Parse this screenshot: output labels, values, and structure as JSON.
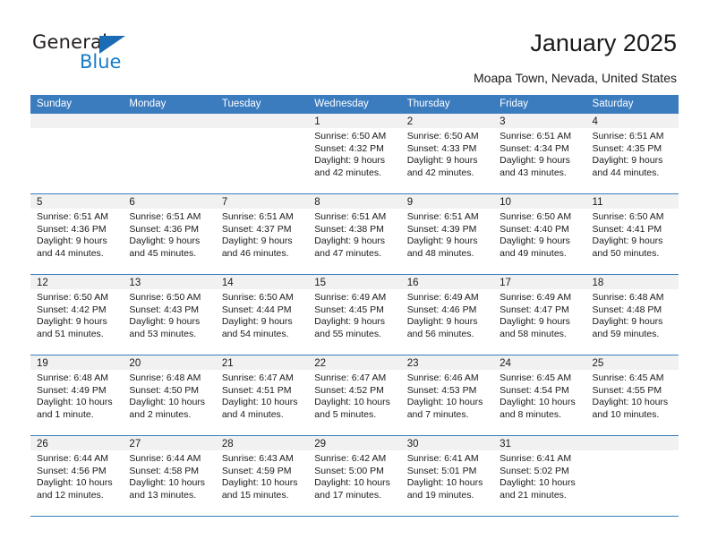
{
  "brand": {
    "name_part1": "General",
    "name_part2": "Blue",
    "triangle_color": "#1c6cb5",
    "blue_color": "#1a7bc6"
  },
  "header": {
    "title": "January 2025",
    "subtitle": "Moapa Town, Nevada, United States",
    "header_bg": "#3b7cbf",
    "daynum_bg": "#f1f1f1"
  },
  "weekdays": [
    "Sunday",
    "Monday",
    "Tuesday",
    "Wednesday",
    "Thursday",
    "Friday",
    "Saturday"
  ],
  "weeks": [
    [
      {
        "day": "",
        "empty": true,
        "l1": "",
        "l2": "",
        "l3": "",
        "l4": ""
      },
      {
        "day": "",
        "empty": true,
        "l1": "",
        "l2": "",
        "l3": "",
        "l4": ""
      },
      {
        "day": "",
        "empty": true,
        "l1": "",
        "l2": "",
        "l3": "",
        "l4": ""
      },
      {
        "day": "1",
        "empty": false,
        "l1": "Sunrise: 6:50 AM",
        "l2": "Sunset: 4:32 PM",
        "l3": "Daylight: 9 hours",
        "l4": "and 42 minutes."
      },
      {
        "day": "2",
        "empty": false,
        "l1": "Sunrise: 6:50 AM",
        "l2": "Sunset: 4:33 PM",
        "l3": "Daylight: 9 hours",
        "l4": "and 42 minutes."
      },
      {
        "day": "3",
        "empty": false,
        "l1": "Sunrise: 6:51 AM",
        "l2": "Sunset: 4:34 PM",
        "l3": "Daylight: 9 hours",
        "l4": "and 43 minutes."
      },
      {
        "day": "4",
        "empty": false,
        "l1": "Sunrise: 6:51 AM",
        "l2": "Sunset: 4:35 PM",
        "l3": "Daylight: 9 hours",
        "l4": "and 44 minutes."
      }
    ],
    [
      {
        "day": "5",
        "empty": false,
        "l1": "Sunrise: 6:51 AM",
        "l2": "Sunset: 4:36 PM",
        "l3": "Daylight: 9 hours",
        "l4": "and 44 minutes."
      },
      {
        "day": "6",
        "empty": false,
        "l1": "Sunrise: 6:51 AM",
        "l2": "Sunset: 4:36 PM",
        "l3": "Daylight: 9 hours",
        "l4": "and 45 minutes."
      },
      {
        "day": "7",
        "empty": false,
        "l1": "Sunrise: 6:51 AM",
        "l2": "Sunset: 4:37 PM",
        "l3": "Daylight: 9 hours",
        "l4": "and 46 minutes."
      },
      {
        "day": "8",
        "empty": false,
        "l1": "Sunrise: 6:51 AM",
        "l2": "Sunset: 4:38 PM",
        "l3": "Daylight: 9 hours",
        "l4": "and 47 minutes."
      },
      {
        "day": "9",
        "empty": false,
        "l1": "Sunrise: 6:51 AM",
        "l2": "Sunset: 4:39 PM",
        "l3": "Daylight: 9 hours",
        "l4": "and 48 minutes."
      },
      {
        "day": "10",
        "empty": false,
        "l1": "Sunrise: 6:50 AM",
        "l2": "Sunset: 4:40 PM",
        "l3": "Daylight: 9 hours",
        "l4": "and 49 minutes."
      },
      {
        "day": "11",
        "empty": false,
        "l1": "Sunrise: 6:50 AM",
        "l2": "Sunset: 4:41 PM",
        "l3": "Daylight: 9 hours",
        "l4": "and 50 minutes."
      }
    ],
    [
      {
        "day": "12",
        "empty": false,
        "l1": "Sunrise: 6:50 AM",
        "l2": "Sunset: 4:42 PM",
        "l3": "Daylight: 9 hours",
        "l4": "and 51 minutes."
      },
      {
        "day": "13",
        "empty": false,
        "l1": "Sunrise: 6:50 AM",
        "l2": "Sunset: 4:43 PM",
        "l3": "Daylight: 9 hours",
        "l4": "and 53 minutes."
      },
      {
        "day": "14",
        "empty": false,
        "l1": "Sunrise: 6:50 AM",
        "l2": "Sunset: 4:44 PM",
        "l3": "Daylight: 9 hours",
        "l4": "and 54 minutes."
      },
      {
        "day": "15",
        "empty": false,
        "l1": "Sunrise: 6:49 AM",
        "l2": "Sunset: 4:45 PM",
        "l3": "Daylight: 9 hours",
        "l4": "and 55 minutes."
      },
      {
        "day": "16",
        "empty": false,
        "l1": "Sunrise: 6:49 AM",
        "l2": "Sunset: 4:46 PM",
        "l3": "Daylight: 9 hours",
        "l4": "and 56 minutes."
      },
      {
        "day": "17",
        "empty": false,
        "l1": "Sunrise: 6:49 AM",
        "l2": "Sunset: 4:47 PM",
        "l3": "Daylight: 9 hours",
        "l4": "and 58 minutes."
      },
      {
        "day": "18",
        "empty": false,
        "l1": "Sunrise: 6:48 AM",
        "l2": "Sunset: 4:48 PM",
        "l3": "Daylight: 9 hours",
        "l4": "and 59 minutes."
      }
    ],
    [
      {
        "day": "19",
        "empty": false,
        "l1": "Sunrise: 6:48 AM",
        "l2": "Sunset: 4:49 PM",
        "l3": "Daylight: 10 hours",
        "l4": "and 1 minute."
      },
      {
        "day": "20",
        "empty": false,
        "l1": "Sunrise: 6:48 AM",
        "l2": "Sunset: 4:50 PM",
        "l3": "Daylight: 10 hours",
        "l4": "and 2 minutes."
      },
      {
        "day": "21",
        "empty": false,
        "l1": "Sunrise: 6:47 AM",
        "l2": "Sunset: 4:51 PM",
        "l3": "Daylight: 10 hours",
        "l4": "and 4 minutes."
      },
      {
        "day": "22",
        "empty": false,
        "l1": "Sunrise: 6:47 AM",
        "l2": "Sunset: 4:52 PM",
        "l3": "Daylight: 10 hours",
        "l4": "and 5 minutes."
      },
      {
        "day": "23",
        "empty": false,
        "l1": "Sunrise: 6:46 AM",
        "l2": "Sunset: 4:53 PM",
        "l3": "Daylight: 10 hours",
        "l4": "and 7 minutes."
      },
      {
        "day": "24",
        "empty": false,
        "l1": "Sunrise: 6:45 AM",
        "l2": "Sunset: 4:54 PM",
        "l3": "Daylight: 10 hours",
        "l4": "and 8 minutes."
      },
      {
        "day": "25",
        "empty": false,
        "l1": "Sunrise: 6:45 AM",
        "l2": "Sunset: 4:55 PM",
        "l3": "Daylight: 10 hours",
        "l4": "and 10 minutes."
      }
    ],
    [
      {
        "day": "26",
        "empty": false,
        "l1": "Sunrise: 6:44 AM",
        "l2": "Sunset: 4:56 PM",
        "l3": "Daylight: 10 hours",
        "l4": "and 12 minutes."
      },
      {
        "day": "27",
        "empty": false,
        "l1": "Sunrise: 6:44 AM",
        "l2": "Sunset: 4:58 PM",
        "l3": "Daylight: 10 hours",
        "l4": "and 13 minutes."
      },
      {
        "day": "28",
        "empty": false,
        "l1": "Sunrise: 6:43 AM",
        "l2": "Sunset: 4:59 PM",
        "l3": "Daylight: 10 hours",
        "l4": "and 15 minutes."
      },
      {
        "day": "29",
        "empty": false,
        "l1": "Sunrise: 6:42 AM",
        "l2": "Sunset: 5:00 PM",
        "l3": "Daylight: 10 hours",
        "l4": "and 17 minutes."
      },
      {
        "day": "30",
        "empty": false,
        "l1": "Sunrise: 6:41 AM",
        "l2": "Sunset: 5:01 PM",
        "l3": "Daylight: 10 hours",
        "l4": "and 19 minutes."
      },
      {
        "day": "31",
        "empty": false,
        "l1": "Sunrise: 6:41 AM",
        "l2": "Sunset: 5:02 PM",
        "l3": "Daylight: 10 hours",
        "l4": "and 21 minutes."
      },
      {
        "day": "",
        "empty": true,
        "l1": "",
        "l2": "",
        "l3": "",
        "l4": ""
      }
    ]
  ]
}
